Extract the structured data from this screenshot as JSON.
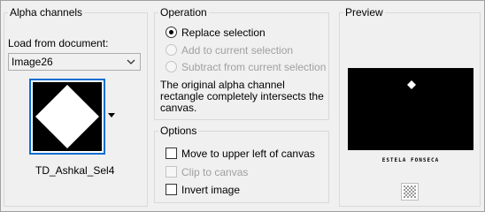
{
  "alpha_channels": {
    "title": "Alpha channels",
    "load_from_label": "Load from document:",
    "document_value": "Image26",
    "channel_name": "TD_Ashkal_Sel4"
  },
  "operation": {
    "title": "Operation",
    "replace": "Replace selection",
    "add": "Add to current selection",
    "subtract": "Subtract from current selection",
    "message_line1": "The original alpha channel",
    "message_line2": "rectangle completely intersects the",
    "message_line3": "canvas."
  },
  "options": {
    "title": "Options",
    "move": "Move to upper left of canvas",
    "clip": "Clip to canvas",
    "invert": "Invert image"
  },
  "preview": {
    "title": "Preview",
    "watermark": "ESTELA FONSECA"
  },
  "colors": {
    "accent": "#0a6ed1",
    "disabled_text": "#a0a0a0",
    "background": "#f0f0f0"
  }
}
